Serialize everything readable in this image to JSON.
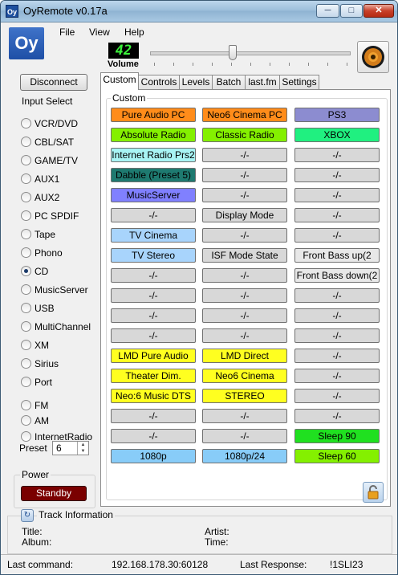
{
  "window": {
    "title": "OyRemote v0.17a",
    "minimize": "─",
    "maximize": "□",
    "close": "✕"
  },
  "menu": [
    "File",
    "View",
    "Help"
  ],
  "logo": "Oy",
  "volume": {
    "value": "42",
    "label": "Volume",
    "level_fraction": 0.42
  },
  "connect_button": "Disconnect",
  "input_select": {
    "label": "Input Select",
    "selected": "CD",
    "items": [
      "VCR/DVD",
      "CBL/SAT",
      "GAME/TV",
      "AUX1",
      "AUX2",
      "PC SPDIF",
      "Tape",
      "Phono",
      "CD",
      "MusicServer",
      "USB",
      "MultiChannel",
      "XM",
      "Sirius",
      "Port",
      "FM",
      "AM",
      "InternetRadio"
    ]
  },
  "preset": {
    "label": "Preset",
    "value": "6"
  },
  "power": {
    "label": "Power",
    "button": "Standby"
  },
  "tabs": [
    "Custom",
    "Controls",
    "Levels",
    "Batch",
    "last.fm",
    "Settings"
  ],
  "active_tab": "Custom",
  "custom": {
    "label": "Custom",
    "buttons": [
      {
        "label": "Pure Audio PC",
        "color": "#ff8c1a"
      },
      {
        "label": "Neo6 Cinema PC",
        "color": "#ff8c1a"
      },
      {
        "label": "PS3",
        "color": "#8c8cd0"
      },
      {
        "label": "Absolute Radio",
        "color": "#84f000"
      },
      {
        "label": "Classic Radio",
        "color": "#84f000"
      },
      {
        "label": "XBOX",
        "color": "#20f080"
      },
      {
        "label": "Internet Radio Prs2",
        "color": "#a8f4f4"
      },
      {
        "label": "-/-",
        "color": "#d8d8d8"
      },
      {
        "label": "-/-",
        "color": "#d8d8d8"
      },
      {
        "label": "Dabble (Preset 5)",
        "color": "#1e7a70"
      },
      {
        "label": "-/-",
        "color": "#d8d8d8"
      },
      {
        "label": "-/-",
        "color": "#d8d8d8"
      },
      {
        "label": "MusicServer",
        "color": "#8080ff"
      },
      {
        "label": "-/-",
        "color": "#d8d8d8"
      },
      {
        "label": "-/-",
        "color": "#d8d8d8"
      },
      {
        "label": "-/-",
        "color": "#d8d8d8"
      },
      {
        "label": "Display Mode",
        "color": "#d8d8d8"
      },
      {
        "label": "-/-",
        "color": "#d8d8d8"
      },
      {
        "label": "TV Cinema",
        "color": "#a8d4fc"
      },
      {
        "label": "-/-",
        "color": "#d8d8d8"
      },
      {
        "label": "-/-",
        "color": "#d8d8d8"
      },
      {
        "label": "TV Stereo",
        "color": "#a8d4fc"
      },
      {
        "label": "ISF Mode State",
        "color": "#d8d8d8"
      },
      {
        "label": "Front Bass up(2",
        "color": "#e8e8e8"
      },
      {
        "label": "-/-",
        "color": "#d8d8d8"
      },
      {
        "label": "-/-",
        "color": "#d8d8d8"
      },
      {
        "label": "Front Bass down(2",
        "color": "#e8e8e8"
      },
      {
        "label": "-/-",
        "color": "#d8d8d8"
      },
      {
        "label": "-/-",
        "color": "#d8d8d8"
      },
      {
        "label": "-/-",
        "color": "#d8d8d8"
      },
      {
        "label": "-/-",
        "color": "#d8d8d8"
      },
      {
        "label": "-/-",
        "color": "#d8d8d8"
      },
      {
        "label": "-/-",
        "color": "#d8d8d8"
      },
      {
        "label": "-/-",
        "color": "#d8d8d8"
      },
      {
        "label": "-/-",
        "color": "#d8d8d8"
      },
      {
        "label": "-/-",
        "color": "#d8d8d8"
      },
      {
        "label": "LMD Pure Audio",
        "color": "#ffff20"
      },
      {
        "label": "LMD Direct",
        "color": "#ffff20"
      },
      {
        "label": "-/-",
        "color": "#d8d8d8"
      },
      {
        "label": "Theater Dim.",
        "color": "#ffff20"
      },
      {
        "label": "Neo6 Cinema",
        "color": "#ffff20"
      },
      {
        "label": "-/-",
        "color": "#d8d8d8"
      },
      {
        "label": "Neo:6 Music DTS",
        "color": "#ffff20"
      },
      {
        "label": "STEREO",
        "color": "#ffff20"
      },
      {
        "label": "-/-",
        "color": "#d8d8d8"
      },
      {
        "label": "-/-",
        "color": "#d8d8d8"
      },
      {
        "label": "-/-",
        "color": "#d8d8d8"
      },
      {
        "label": "-/-",
        "color": "#d8d8d8"
      },
      {
        "label": "-/-",
        "color": "#d8d8d8"
      },
      {
        "label": "-/-",
        "color": "#d8d8d8"
      },
      {
        "label": "Sleep 90",
        "color": "#20e020"
      },
      {
        "label": "1080p",
        "color": "#88ccf8"
      },
      {
        "label": "1080p/24",
        "color": "#88ccf8"
      },
      {
        "label": "Sleep 60",
        "color": "#84f000"
      }
    ]
  },
  "track": {
    "label": "Track Information",
    "title_label": "Title:",
    "album_label": "Album:",
    "artist_label": "Artist:",
    "time_label": "Time:"
  },
  "status": {
    "last_command_label": "Last command:",
    "address": "192.168.178.30:60128",
    "last_response_label": "Last Response:",
    "last_response": "!1SLI23"
  },
  "colors": {
    "standby": "#7a0000",
    "vol_lcd": "#3bf03b"
  }
}
